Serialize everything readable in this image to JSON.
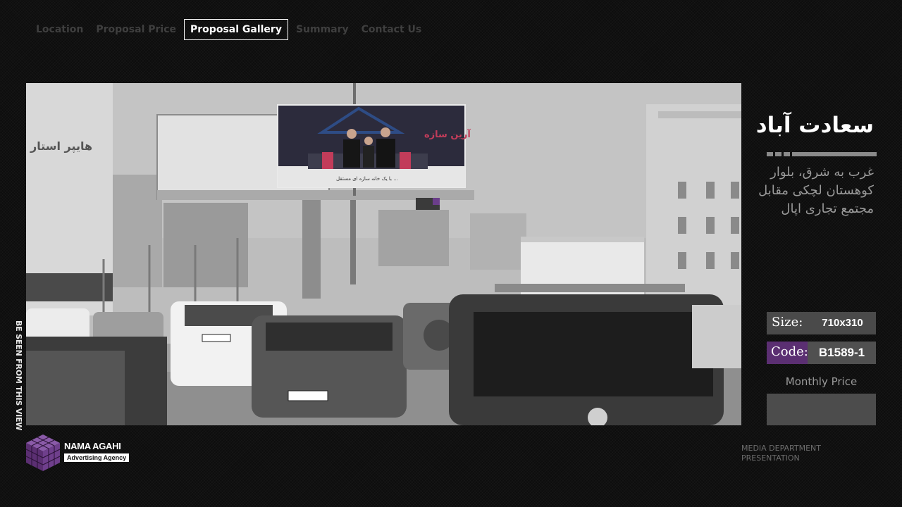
{
  "nav": {
    "items": [
      {
        "label": "Location",
        "active": false
      },
      {
        "label": "Proposal Price",
        "active": false
      },
      {
        "label": "Proposal Gallery",
        "active": true
      },
      {
        "label": "Summary",
        "active": false
      },
      {
        "label": "Contact Us",
        "active": false
      }
    ]
  },
  "photo": {
    "billboard_brand": "آرین سازه",
    "billboard_tagline": "با یک خانه سازه ای مستقل ..."
  },
  "side_label": "BE SEEN FROM THIS VIEW",
  "details": {
    "title": "سعادت آباد",
    "address": "غرب به شرق، بلوار کوهستان لچکی مقابل مجتمع تجاری اپال",
    "size_label": "Size:",
    "size_value": "710x310",
    "code_label": "Code:",
    "code_value": "B1589-1",
    "monthly_price_label": "Monthly Price",
    "monthly_price_value": ""
  },
  "footer": {
    "logo_name": "NAMA AGAHI",
    "logo_subtitle": "Advertising Agency",
    "department_line1": "MEDIA DEPARTMENT",
    "department_line2": "PRESENTATION"
  },
  "colors": {
    "background": "#0d0d0d",
    "accent_purple": "#5b2f72",
    "panel_gray": "#4a4a4a",
    "active_nav": "#ffffff",
    "inactive_nav": "#3f3f3f"
  },
  "icons": {
    "logo": "purple-cube-logo-icon"
  }
}
